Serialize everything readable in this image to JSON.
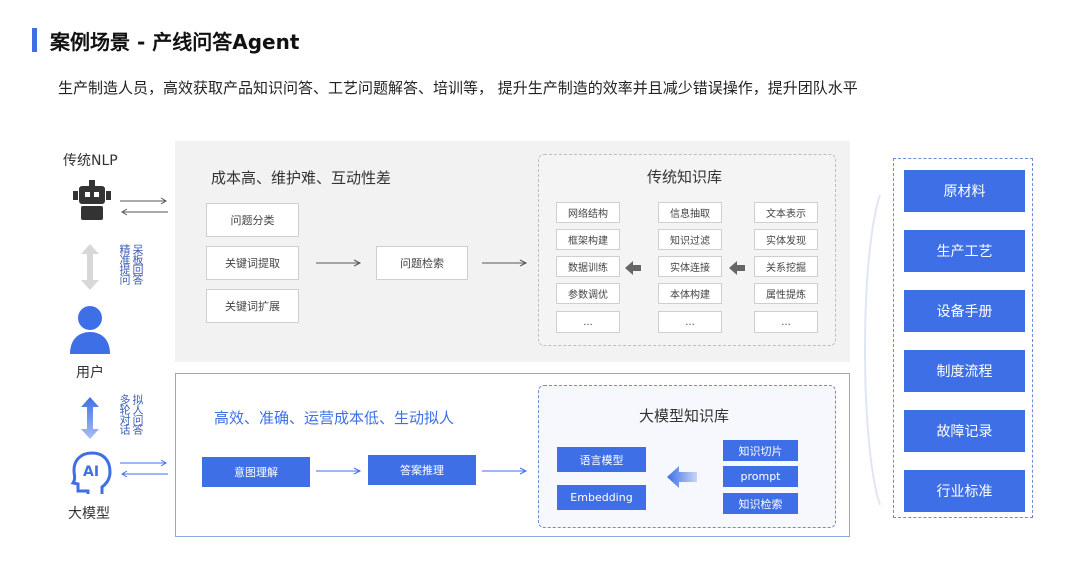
{
  "header": {
    "title": "案例场景 - 产线问答Agent",
    "subtitle": "生产制造人员，高效获取产品知识问答、工艺问题解答、培训等，   提升生产制造的效率并且减少错误操作，提升团队水平"
  },
  "left": {
    "nlp_label": "传统NLP",
    "user_label": "用户",
    "ai_label": "大模型",
    "ai_icon_text": "AI",
    "upper_note_1": "呆板回答",
    "upper_note_2": "精准提问",
    "lower_note_1": "拟人问答",
    "lower_note_2": "多轮对话"
  },
  "traditional": {
    "heading": "成本高、维护难、互动性差",
    "steps": [
      "问题分类",
      "关键词提取",
      "关键词扩展"
    ],
    "retrieval": "问题检索",
    "kb_title": "传统知识库",
    "kb_col1": [
      "网络结构",
      "框架构建",
      "数据训练",
      "参数调优",
      "..."
    ],
    "kb_col2": [
      "信息抽取",
      "知识过滤",
      "实体连接",
      "本体构建",
      "..."
    ],
    "kb_col3": [
      "文本表示",
      "实体发现",
      "关系挖掘",
      "属性提炼",
      "..."
    ]
  },
  "llm": {
    "heading": "高效、准确、运营成本低、生动拟人",
    "intent": "意图理解",
    "reasoning": "答案推理",
    "kb_title": "大模型知识库",
    "models": [
      "语言模型",
      "Embedding"
    ],
    "tools": [
      "知识切片",
      "prompt",
      "知识检索"
    ]
  },
  "sources": [
    "原材料",
    "生产工艺",
    "设备手册",
    "制度流程",
    "故障记录",
    "行业标准"
  ],
  "colors": {
    "accent": "#3f6fe6",
    "panel_gray": "#f2f2f2"
  }
}
